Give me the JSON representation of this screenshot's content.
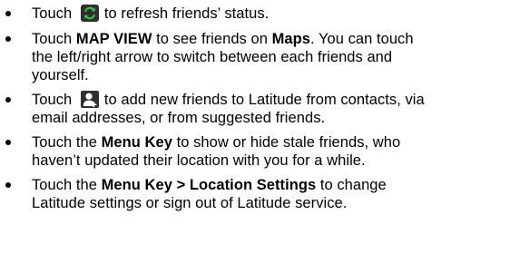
{
  "items": [
    {
      "prefix": "Touch",
      "icon": "refresh-icon",
      "suffix": "to refresh friends’ status."
    },
    {
      "t1": "Touch ",
      "b1": "MAP VIEW",
      "t2": " to see friends on ",
      "b2": "Maps",
      "t3": ". You can touch",
      "line2": "the left/right arrow to switch between each friends and",
      "line3": "yourself."
    },
    {
      "prefix": "Touch",
      "icon": "add-friend-icon",
      "suffix": "to add new friends to Latitude from contacts, via",
      "line2": "email addresses, or from suggested friends."
    },
    {
      "t1": "Touch the ",
      "b1": "Menu Key",
      "t2": " to show or hide stale friends, who",
      "line2": "haven’t updated their location with you for a while."
    },
    {
      "t1": "Touch the ",
      "b1": "Menu Key > Location Settings",
      "t2": " to change",
      "line2": "Latitude settings or sign out of Latitude service."
    }
  ],
  "colors": {
    "icon_bg": "#2f2f2f",
    "icon_fg": "#3fbf4f"
  }
}
